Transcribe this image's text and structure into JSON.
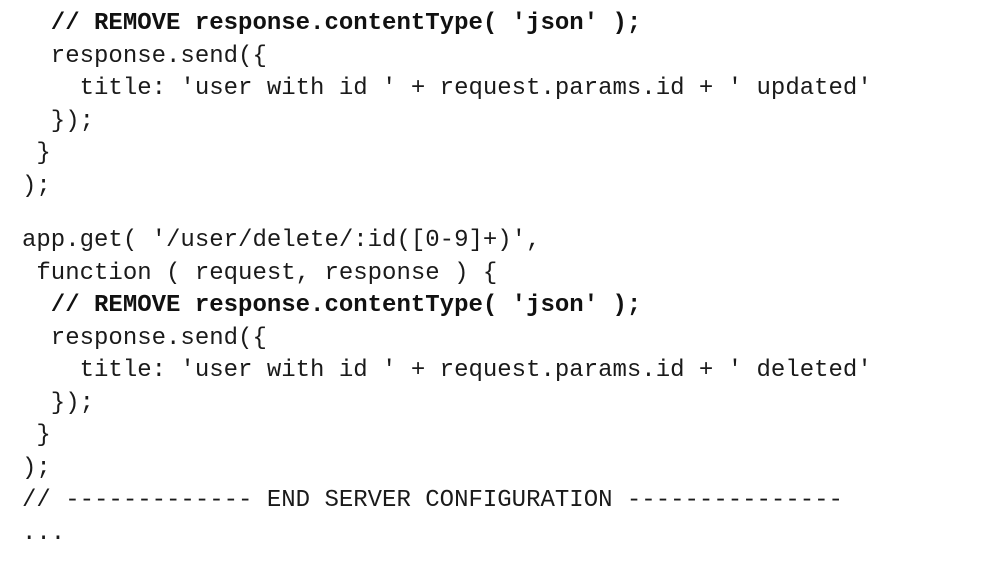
{
  "code": {
    "lines": [
      "  // REMOVE response.contentType( 'json' );",
      "  response.send({",
      "    title: 'user with id ' + request.params.id + ' updated'",
      "  });",
      " }",
      ");",
      "",
      "app.get( '/user/delete/:id([0-9]+)',",
      " function ( request, response ) {",
      "  // REMOVE response.contentType( 'json' );",
      "  response.send({",
      "    title: 'user with id ' + request.params.id + ' deleted'",
      "  });",
      " }",
      ");",
      "// ------------- END SERVER CONFIGURATION ---------------",
      "..."
    ]
  }
}
